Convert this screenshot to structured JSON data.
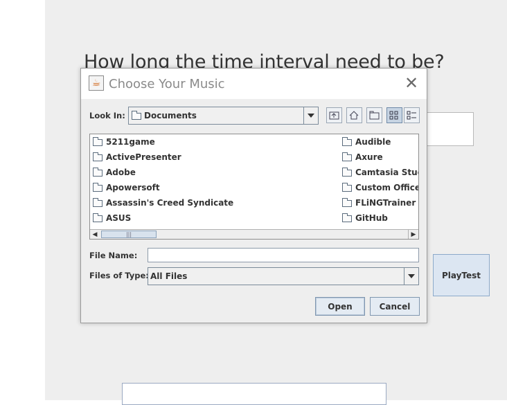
{
  "background": {
    "question": "How long the time interval need to be?",
    "interval_value": "",
    "playtest_label": "PlayTest",
    "bottom_value": ""
  },
  "dialog": {
    "title": "Choose Your Music",
    "close_glyph": "✕",
    "look_in_label": "Look In:",
    "look_in_value": "Documents",
    "toolbar": {
      "up_icon": "up-folder-icon",
      "home_icon": "home-icon",
      "new_folder_icon": "new-folder-icon",
      "list_view_icon": "list-view-icon",
      "details_view_icon": "details-view-icon"
    },
    "files_col1": [
      "5211game",
      "ActivePresenter",
      "Adobe",
      "Apowersoft",
      "Assassin's Creed Syndicate",
      "ASUS"
    ],
    "files_col2": [
      "Audible",
      "Axure",
      "Camtasia Studio",
      "Custom Office Te",
      "FLiNGTrainer",
      "GitHub"
    ],
    "file_name_label": "File Name:",
    "file_name_value": "",
    "files_of_type_label": "Files of Type:",
    "files_of_type_value": "All Files",
    "open_label": "Open",
    "cancel_label": "Cancel"
  }
}
